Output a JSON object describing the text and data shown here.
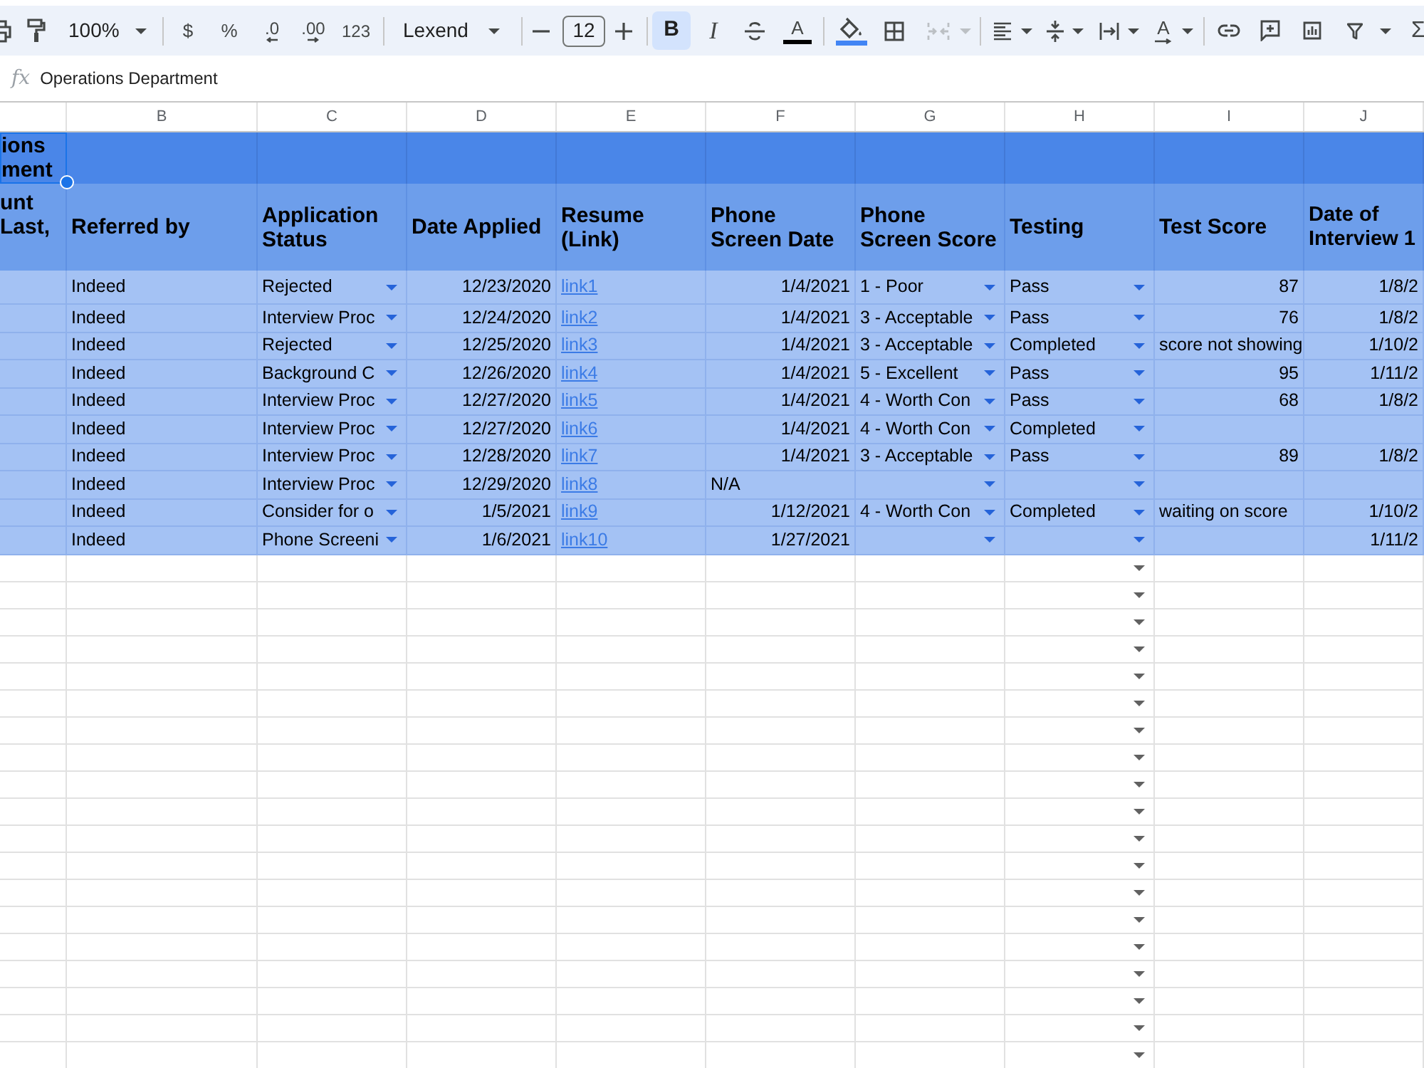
{
  "toolbar": {
    "zoom": "100%",
    "currency": "$",
    "percent": "%",
    "decrease_decimals": ".0",
    "increase_decimals": ".00",
    "number_formats": "123",
    "font": "Lexend",
    "font_size": "12",
    "bold": {
      "label": "B",
      "selected": true
    },
    "italic": {
      "label": "I",
      "selected": false
    },
    "text_color": "A",
    "merge_cells": {
      "disabled": true
    },
    "text_rotation": "A",
    "functions": "Σ"
  },
  "formula_bar": {
    "label": "fx",
    "value": "Operations Department"
  },
  "sheet": {
    "column_letters": [
      "B",
      "C",
      "D",
      "E",
      "F",
      "G",
      "H",
      "I",
      "J"
    ],
    "title_row": {
      "text": "ions ment",
      "selected": true
    },
    "header_row": [
      "unt Last,",
      "Referred by",
      "Application Status",
      "Date Applied",
      "Resume (Link)",
      "Phone Screen Date",
      "Phone Screen Score",
      "Testing",
      "Test Score",
      "Date of Interview 1"
    ],
    "rows": [
      {
        "cells": [
          {
            "kind": "text",
            "text": "Indeed"
          },
          {
            "kind": "choice",
            "text": "Rejected"
          },
          {
            "kind": "number",
            "text": "12/23/2020"
          },
          {
            "kind": "link",
            "text": "link1"
          },
          {
            "kind": "number",
            "text": "1/4/2021"
          },
          {
            "kind": "choice",
            "text": "1 - Poor"
          },
          {
            "kind": "choice",
            "text": "Pass"
          },
          {
            "kind": "number",
            "text": "87"
          },
          {
            "kind": "number",
            "text": "1/8/2"
          }
        ]
      },
      {
        "cells": [
          {
            "kind": "text",
            "text": "Indeed"
          },
          {
            "kind": "choice",
            "text": "Interview Proc"
          },
          {
            "kind": "number",
            "text": "12/24/2020"
          },
          {
            "kind": "link",
            "text": "link2"
          },
          {
            "kind": "number",
            "text": "1/4/2021"
          },
          {
            "kind": "choice",
            "text": "3 - Acceptable"
          },
          {
            "kind": "choice",
            "text": "Pass"
          },
          {
            "kind": "number",
            "text": "76"
          },
          {
            "kind": "number",
            "text": "1/8/2"
          }
        ]
      },
      {
        "cells": [
          {
            "kind": "text",
            "text": "Indeed"
          },
          {
            "kind": "choice",
            "text": "Rejected"
          },
          {
            "kind": "number",
            "text": "12/25/2020"
          },
          {
            "kind": "link",
            "text": "link3"
          },
          {
            "kind": "number",
            "text": "1/4/2021"
          },
          {
            "kind": "choice",
            "text": "3 - Acceptable"
          },
          {
            "kind": "choice",
            "text": "Completed"
          },
          {
            "kind": "text",
            "text": "score not showing"
          },
          {
            "kind": "number",
            "text": "1/10/2"
          }
        ]
      },
      {
        "cells": [
          {
            "kind": "text",
            "text": "Indeed"
          },
          {
            "kind": "choice",
            "text": "Background C"
          },
          {
            "kind": "number",
            "text": "12/26/2020"
          },
          {
            "kind": "link",
            "text": "link4"
          },
          {
            "kind": "number",
            "text": "1/4/2021"
          },
          {
            "kind": "choice",
            "text": "5 - Excellent"
          },
          {
            "kind": "choice",
            "text": "Pass"
          },
          {
            "kind": "number",
            "text": "95"
          },
          {
            "kind": "number",
            "text": "1/11/2"
          }
        ]
      },
      {
        "cells": [
          {
            "kind": "text",
            "text": "Indeed"
          },
          {
            "kind": "choice",
            "text": "Interview Proc"
          },
          {
            "kind": "number",
            "text": "12/27/2020"
          },
          {
            "kind": "link",
            "text": "link5"
          },
          {
            "kind": "number",
            "text": "1/4/2021"
          },
          {
            "kind": "choice",
            "text": "4 - Worth Con"
          },
          {
            "kind": "choice",
            "text": "Pass"
          },
          {
            "kind": "number",
            "text": "68"
          },
          {
            "kind": "number",
            "text": "1/8/2"
          }
        ]
      },
      {
        "cells": [
          {
            "kind": "text",
            "text": "Indeed"
          },
          {
            "kind": "choice",
            "text": "Interview Proc"
          },
          {
            "kind": "number",
            "text": "12/27/2020"
          },
          {
            "kind": "link",
            "text": "link6"
          },
          {
            "kind": "number",
            "text": "1/4/2021"
          },
          {
            "kind": "choice",
            "text": "4 - Worth Con"
          },
          {
            "kind": "choice",
            "text": "Completed"
          },
          {
            "kind": "blank"
          },
          {
            "kind": "blank"
          }
        ]
      },
      {
        "cells": [
          {
            "kind": "text",
            "text": "Indeed"
          },
          {
            "kind": "choice",
            "text": "Interview Proc"
          },
          {
            "kind": "number",
            "text": "12/28/2020"
          },
          {
            "kind": "link",
            "text": "link7"
          },
          {
            "kind": "number",
            "text": "1/4/2021"
          },
          {
            "kind": "choice",
            "text": "3 - Acceptable"
          },
          {
            "kind": "choice",
            "text": "Pass"
          },
          {
            "kind": "number",
            "text": "89"
          },
          {
            "kind": "number",
            "text": "1/8/2"
          }
        ]
      },
      {
        "cells": [
          {
            "kind": "text",
            "text": "Indeed"
          },
          {
            "kind": "choice",
            "text": "Interview Proc"
          },
          {
            "kind": "number",
            "text": "12/29/2020"
          },
          {
            "kind": "link",
            "text": "link8"
          },
          {
            "kind": "text",
            "text": "N/A"
          },
          {
            "kind": "choice"
          },
          {
            "kind": "choice"
          },
          {
            "kind": "blank"
          },
          {
            "kind": "blank"
          }
        ]
      },
      {
        "cells": [
          {
            "kind": "text",
            "text": "Indeed"
          },
          {
            "kind": "choice",
            "text": "Consider for o"
          },
          {
            "kind": "number",
            "text": "1/5/2021"
          },
          {
            "kind": "link",
            "text": "link9"
          },
          {
            "kind": "number",
            "text": "1/12/2021"
          },
          {
            "kind": "choice",
            "text": "4 - Worth Con"
          },
          {
            "kind": "choice",
            "text": "Completed"
          },
          {
            "kind": "text",
            "text": "waiting on score"
          },
          {
            "kind": "number",
            "text": "1/10/2"
          }
        ]
      },
      {
        "cells": [
          {
            "kind": "text",
            "text": "Indeed"
          },
          {
            "kind": "choice",
            "text": "Phone Screeni"
          },
          {
            "kind": "number",
            "text": "1/6/2021"
          },
          {
            "kind": "link",
            "text": "link10"
          },
          {
            "kind": "number",
            "text": "1/27/2021"
          },
          {
            "kind": "choice"
          },
          {
            "kind": "choice"
          },
          {
            "kind": "blank"
          },
          {
            "kind": "number",
            "text": "1/11/2"
          }
        ]
      }
    ],
    "empty_rows": [
      {
        "testing_dropdown": true
      },
      {
        "testing_dropdown": true
      },
      {
        "testing_dropdown": true
      },
      {
        "testing_dropdown": true
      },
      {
        "testing_dropdown": true
      },
      {
        "testing_dropdown": true
      },
      {
        "testing_dropdown": true
      },
      {
        "testing_dropdown": true
      },
      {
        "testing_dropdown": true
      },
      {
        "testing_dropdown": true
      },
      {
        "testing_dropdown": true
      },
      {
        "testing_dropdown": true
      },
      {
        "testing_dropdown": true
      },
      {
        "testing_dropdown": true
      },
      {
        "testing_dropdown": true
      },
      {
        "testing_dropdown": true
      },
      {
        "testing_dropdown": true
      },
      {
        "testing_dropdown": true
      },
      {
        "testing_dropdown": true
      }
    ]
  }
}
